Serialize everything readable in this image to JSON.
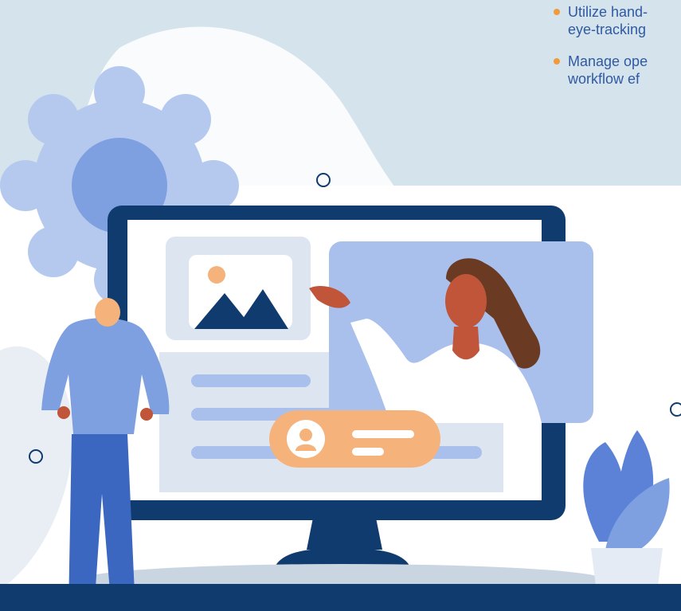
{
  "bullets": [
    {
      "line1": "Utilize hand-",
      "line2": "eye-tracking"
    },
    {
      "line1": "Manage ope",
      "line2": "workflow ef"
    }
  ],
  "colors": {
    "navy": "#0f3b6e",
    "primary_blue": "#2f5aa3",
    "light_blue": "#a9c0ec",
    "orange": "#f6b27b",
    "accent_orange": "#f29a3a",
    "band": "#d5e3ec"
  },
  "icons": [
    "gear-icon",
    "image-icon",
    "user-icon",
    "plant-icon"
  ]
}
